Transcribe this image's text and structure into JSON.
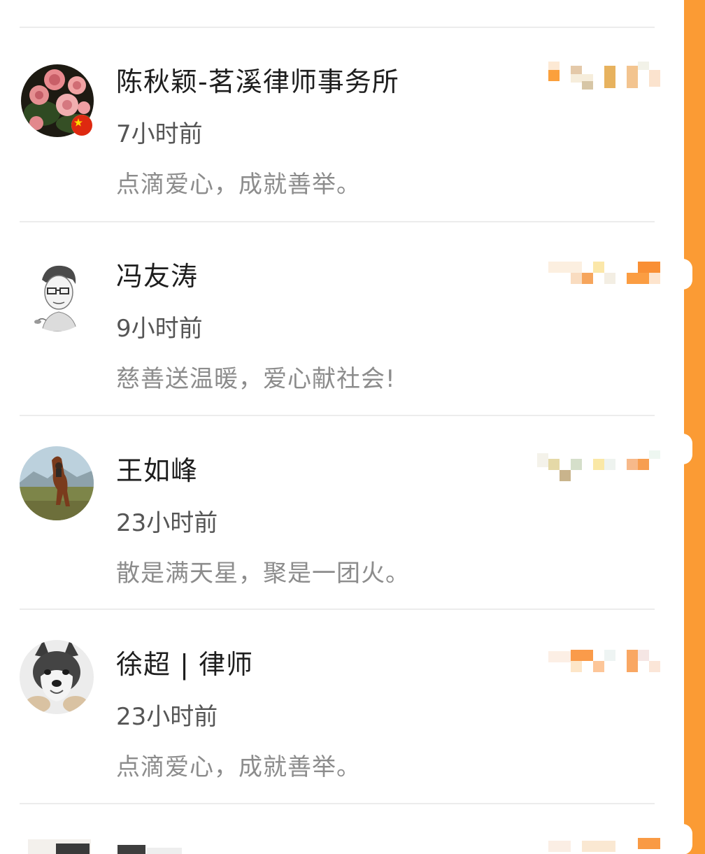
{
  "comments": [
    {
      "name": "陈秋颖-茗溪律师事务所",
      "time": "7小时前",
      "text": "点滴爱心，成就善举。",
      "avatar": "rose-flowers-avatar-icon",
      "badge": "china-flag-icon"
    },
    {
      "name": "冯友涛",
      "time": "9小时前",
      "text": "慈善送温暖，爱心献社会!",
      "avatar": "sketch-portrait-avatar-icon"
    },
    {
      "name": "王如峰",
      "time": "23小时前",
      "text": "散是满天星，聚是一团火。",
      "avatar": "rearing-horse-avatar-icon"
    },
    {
      "name": "徐超 | 律师",
      "time": "23小时前",
      "text": "点滴爱心，成就善举。",
      "avatar": "husky-dog-avatar-icon"
    }
  ],
  "colors": {
    "accent_strip": "#fb9b34",
    "name_text": "#1e1e1e",
    "time_text": "#555555",
    "comment_text": "#8c8c8c",
    "divider": "#ececec"
  }
}
